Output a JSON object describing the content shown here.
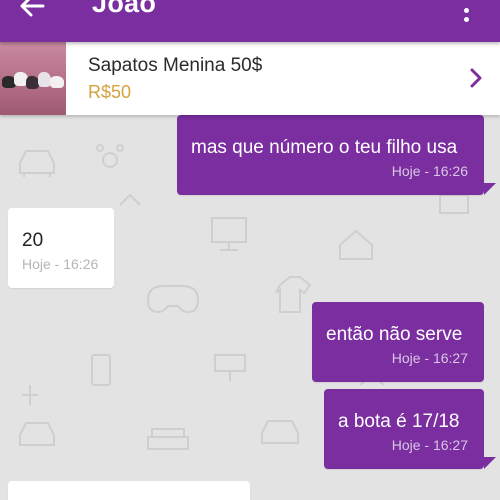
{
  "header": {
    "title": "João",
    "back_icon": "arrow-left-icon",
    "menu_icon": "more-vert-icon",
    "color": "#7a2e9f"
  },
  "listing": {
    "title": "Sapatos Menina 50$",
    "price": "R$50",
    "price_color": "#d6a13d",
    "chevron_icon": "chevron-right-icon"
  },
  "messages": [
    {
      "direction": "out",
      "text": "mas que número o teu filho usa",
      "time": "Hoje - 16:26"
    },
    {
      "direction": "in",
      "text": "20",
      "time": "Hoje - 16:26"
    },
    {
      "direction": "out",
      "text": "então não serve",
      "time": "Hoje - 16:27"
    },
    {
      "direction": "out",
      "text": "a bota é 17/18",
      "time": "Hoje - 16:27"
    }
  ]
}
